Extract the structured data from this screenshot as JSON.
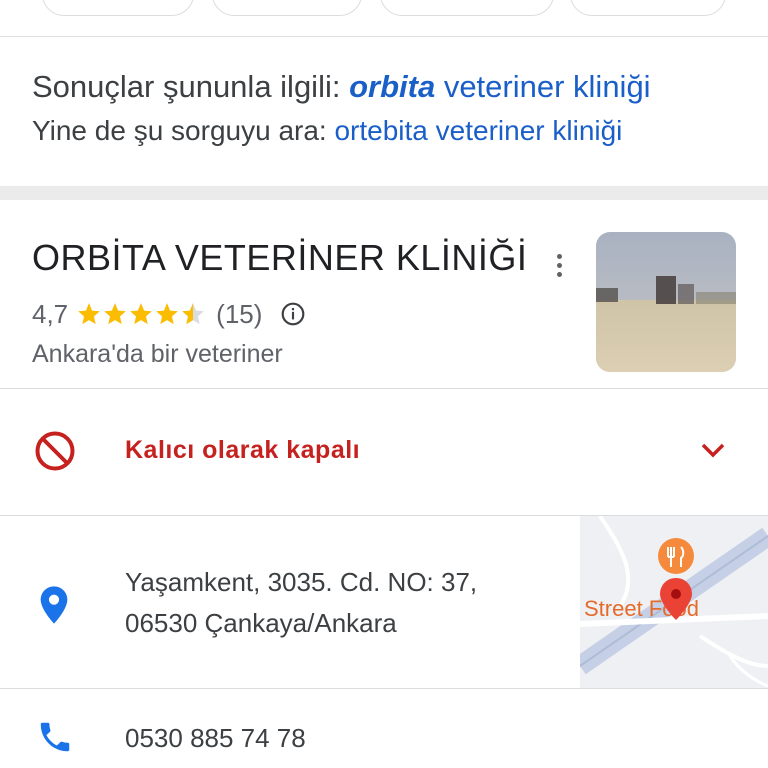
{
  "correction": {
    "prefix": "Sonuçlar şununla ilgili: ",
    "corrected_bold": "orbita",
    "corrected_rest": " veteriner kliniği",
    "original_prefix": "Yine de şu sorguyu ara: ",
    "original_query": "ortebita veteriner kliniği"
  },
  "business": {
    "name": "ORBİTA VETERİNER KLİNİĞİ",
    "rating": "4,7",
    "rating_value": 4.7,
    "reviews": "(15)",
    "category": "Ankara'da bir veteriner"
  },
  "status": {
    "label": "Kalıcı olarak kapalı",
    "color": "#c5221f"
  },
  "address": {
    "line1": "Yaşamkent, 3035. Cd. NO: 37,",
    "line2": "06530 Çankaya/Ankara"
  },
  "map": {
    "label": "Street Food"
  },
  "phone": {
    "number": "0530 885 74 78"
  },
  "colors": {
    "link": "#1a5fc8",
    "star": "#fbbc04",
    "pin": "#1a73e8",
    "closed": "#c5221f"
  }
}
